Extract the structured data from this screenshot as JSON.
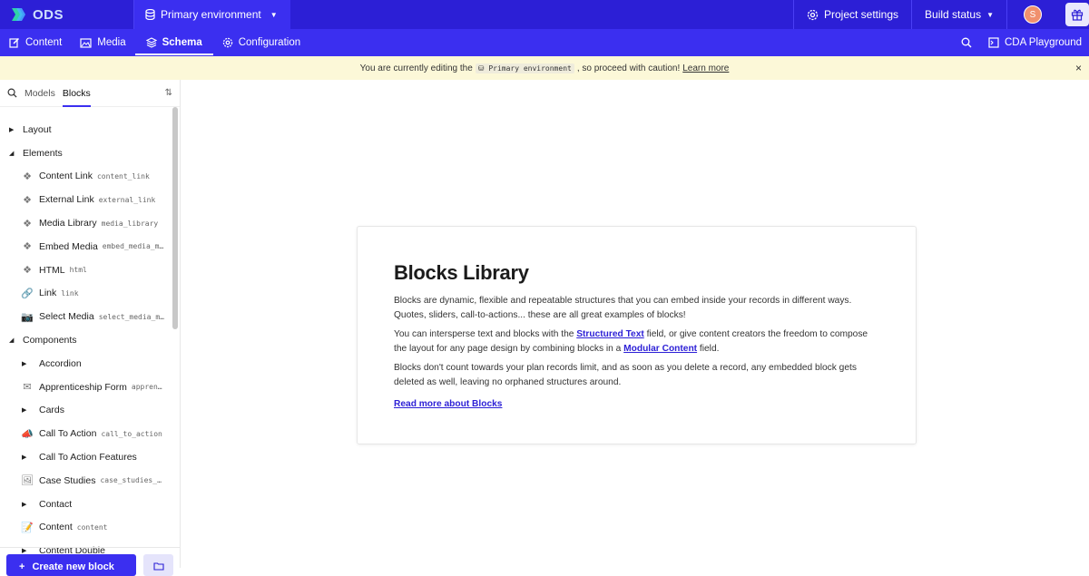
{
  "brand": {
    "logo_text": "ODS"
  },
  "topbar": {
    "environment": "Primary environment",
    "project_settings": "Project settings",
    "build_status": "Build status",
    "avatar_initial": "S"
  },
  "nav": {
    "items": [
      {
        "label": "Content",
        "icon": "pencil-icon",
        "active": false
      },
      {
        "label": "Media",
        "icon": "image-icon",
        "active": false
      },
      {
        "label": "Schema",
        "icon": "layers-icon",
        "active": true
      },
      {
        "label": "Configuration",
        "icon": "gear-icon",
        "active": false
      }
    ],
    "cda_playground": "CDA Playground"
  },
  "banner": {
    "prefix": "You are currently editing the",
    "env_code": "Primary environment",
    "suffix": ", so proceed with caution!",
    "link": "Learn more",
    "close": "×"
  },
  "sidebar": {
    "tab_models": "Models",
    "tab_blocks": "Blocks",
    "sort_symbol": "⇅",
    "tree": [
      {
        "type": "group",
        "label": "Layout",
        "expanded": false
      },
      {
        "type": "group",
        "label": "Elements",
        "expanded": true
      },
      {
        "type": "block",
        "label": "Content Link",
        "api": "content_link",
        "icon": "block-icon"
      },
      {
        "type": "block",
        "label": "External Link",
        "api": "external_link",
        "icon": "block-icon"
      },
      {
        "type": "block",
        "label": "Media Library",
        "api": "media_library",
        "icon": "block-icon"
      },
      {
        "type": "block",
        "label": "Embed Media",
        "api": "embed_media_m…",
        "icon": "block-icon"
      },
      {
        "type": "block",
        "label": "HTML",
        "api": "html",
        "icon": "block-icon"
      },
      {
        "type": "block",
        "label": "Link",
        "api": "link",
        "icon": "link-icon"
      },
      {
        "type": "block",
        "label": "Select Media",
        "api": "select_media_m…",
        "icon": "camera-icon"
      },
      {
        "type": "group",
        "label": "Components",
        "expanded": true
      },
      {
        "type": "subgroup",
        "label": "Accordion"
      },
      {
        "type": "block",
        "label": "Apprenticeship Form",
        "api": "appren…",
        "icon": "envelope-icon"
      },
      {
        "type": "subgroup",
        "label": "Cards"
      },
      {
        "type": "block",
        "label": "Call To Action",
        "api": "call_to_action",
        "icon": "megaphone-icon"
      },
      {
        "type": "subgroup",
        "label": "Call To Action Features"
      },
      {
        "type": "block",
        "label": "Case Studies",
        "api": "case_studies_…",
        "icon": "picture-icon"
      },
      {
        "type": "subgroup",
        "label": "Contact"
      },
      {
        "type": "block",
        "label": "Content",
        "api": "content",
        "icon": "memo-icon"
      },
      {
        "type": "subgroup",
        "label": "Content Double"
      }
    ],
    "create_button": "Create new block"
  },
  "card": {
    "title": "Blocks Library",
    "p1": "Blocks are dynamic, flexible and repeatable structures that you can embed inside your records in different ways. Quotes, sliders, call-to-actions... these are all great examples of blocks!",
    "p2_a": "You can intersperse text and blocks with the ",
    "p2_link1": "Structured Text",
    "p2_b": " field, or give content creators the freedom to compose the layout for any page design by combining blocks in a ",
    "p2_link2": "Modular Content",
    "p2_c": " field.",
    "p3": "Blocks don't count towards your plan records limit, and as soon as you delete a record, any embedded block gets deleted as well, leaving no orphaned structures around.",
    "read_more": "Read more about Blocks"
  },
  "colors": {
    "topbar": "#2c1fd6",
    "navbar": "#3b2ff0",
    "banner": "#fcf8d8"
  }
}
